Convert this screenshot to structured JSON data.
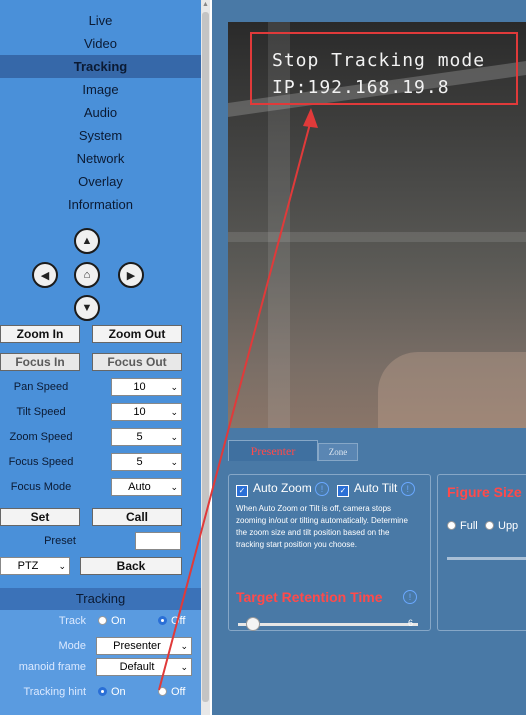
{
  "sidebar": {
    "menu": [
      {
        "label": "Live"
      },
      {
        "label": "Video"
      },
      {
        "label": "Tracking",
        "active": true
      },
      {
        "label": "Image"
      },
      {
        "label": "Audio"
      },
      {
        "label": "System"
      },
      {
        "label": "Network"
      },
      {
        "label": "Overlay"
      },
      {
        "label": "Information"
      }
    ],
    "ptz_pad_icons": [
      "arrow-up-icon",
      "arrow-left-icon",
      "home-icon",
      "arrow-right-icon",
      "arrow-down-icon"
    ],
    "zoom_in": "Zoom In",
    "zoom_out": "Zoom Out",
    "focus_in": "Focus In",
    "focus_out": "Focus Out",
    "settings": [
      {
        "label": "Pan Speed",
        "value": "10"
      },
      {
        "label": "Tilt Speed",
        "value": "10"
      },
      {
        "label": "Zoom Speed",
        "value": "5"
      },
      {
        "label": "Focus Speed",
        "value": "5"
      },
      {
        "label": "Focus Mode",
        "value": "Auto"
      }
    ],
    "set": "Set",
    "call": "Call",
    "preset_label": "Preset",
    "preset_value": "",
    "mode_select": "PTZ",
    "back": "Back",
    "tracking": {
      "title": "Tracking",
      "track_label": "Track",
      "track_on": "On",
      "track_off": "Off",
      "mode_label": "Mode",
      "mode_value": "Presenter",
      "frame_label": "manoid frame",
      "frame_value": "Default",
      "hint_label": "Tracking hint",
      "hint_on": "On",
      "hint_off": "Off"
    }
  },
  "video": {
    "osd_line1": "Stop Tracking mode",
    "osd_line2": "IP:192.168.19.8"
  },
  "tabs": {
    "presenter": "Presenter",
    "zone": "Zone"
  },
  "presenter_panel": {
    "auto_zoom": "Auto Zoom",
    "auto_tilt": "Auto Tilt",
    "description": "When Auto Zoom or Tilt is off, camera stops zooming in/out or tilting automatically. Determine the zoom size and tilt position based on the tracking start position you choose.",
    "retention_title": "Target Retention Time",
    "retention_value": "6"
  },
  "figure_panel": {
    "title": "Figure Size",
    "option_full": "Full",
    "option_upper": "Upp"
  },
  "colors": {
    "sidebar_bg": "#4a90d9",
    "active_bg": "#3668a9",
    "main_bg": "#4979a6",
    "accent_red": "#ff4a4a",
    "annotation": "#e03a3a"
  }
}
